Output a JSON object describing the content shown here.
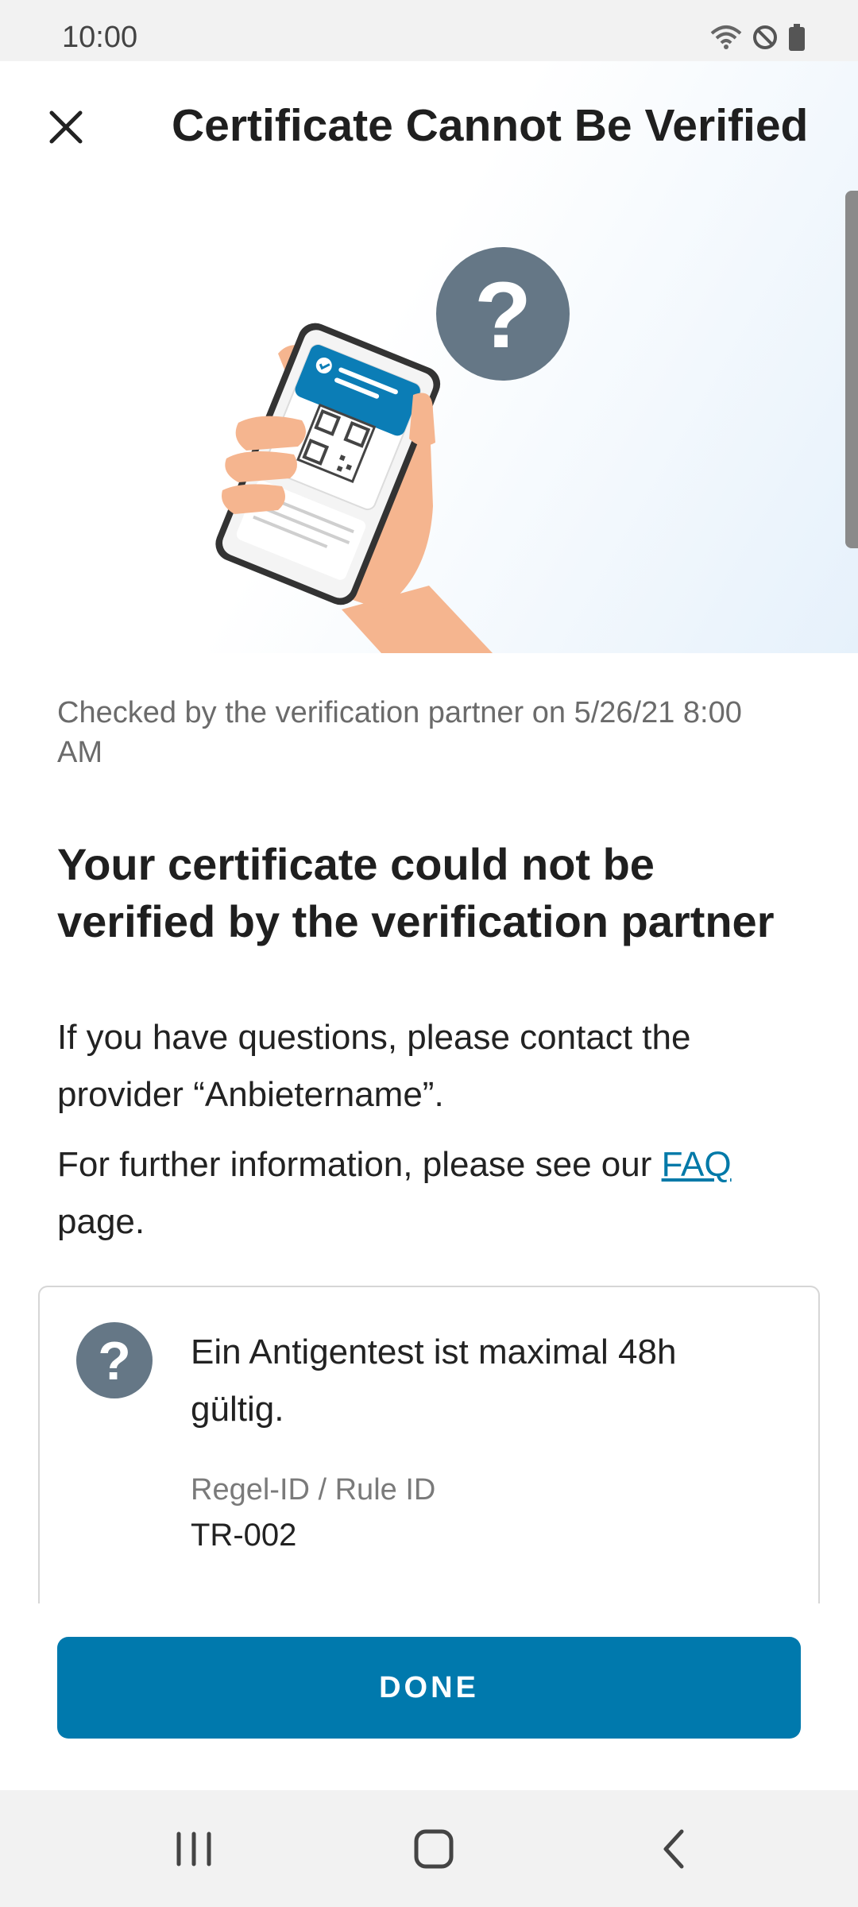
{
  "status_bar": {
    "time": "10:00",
    "icons": [
      "wifi-icon",
      "do-not-disturb-icon",
      "battery-icon"
    ]
  },
  "header": {
    "close_icon": "close-icon",
    "title": "Certificate Cannot Be Verified"
  },
  "hero": {
    "illustration": "phone-with-certificate-qr-and-question-mark",
    "question_glyph": "?"
  },
  "content": {
    "checked_text": "Checked by the verification partner on 5/26/21 8:00 AM",
    "heading": "Your certificate could not be verified by the verification partner",
    "para1": "If you have questions, please contact the provider “Anbietername”.",
    "para2_prefix": "For further information, please see our ",
    "faq_link": "FAQ",
    "para2_suffix": " page."
  },
  "rule_card": {
    "icon": "question-circle-icon",
    "icon_glyph": "?",
    "text": "Ein Antigentest ist maximal 48h gültig.",
    "rule_id_label": "Regel-ID / Rule ID",
    "rule_id_value": "TR-002"
  },
  "done_button": {
    "label": "DONE"
  },
  "nav_bar": {
    "items": [
      "recent-apps-icon",
      "home-icon",
      "back-icon"
    ]
  },
  "colors": {
    "accent": "#0079ad",
    "link": "#0079a8",
    "question_badge": "#657786",
    "skin": "#f5b58f"
  }
}
